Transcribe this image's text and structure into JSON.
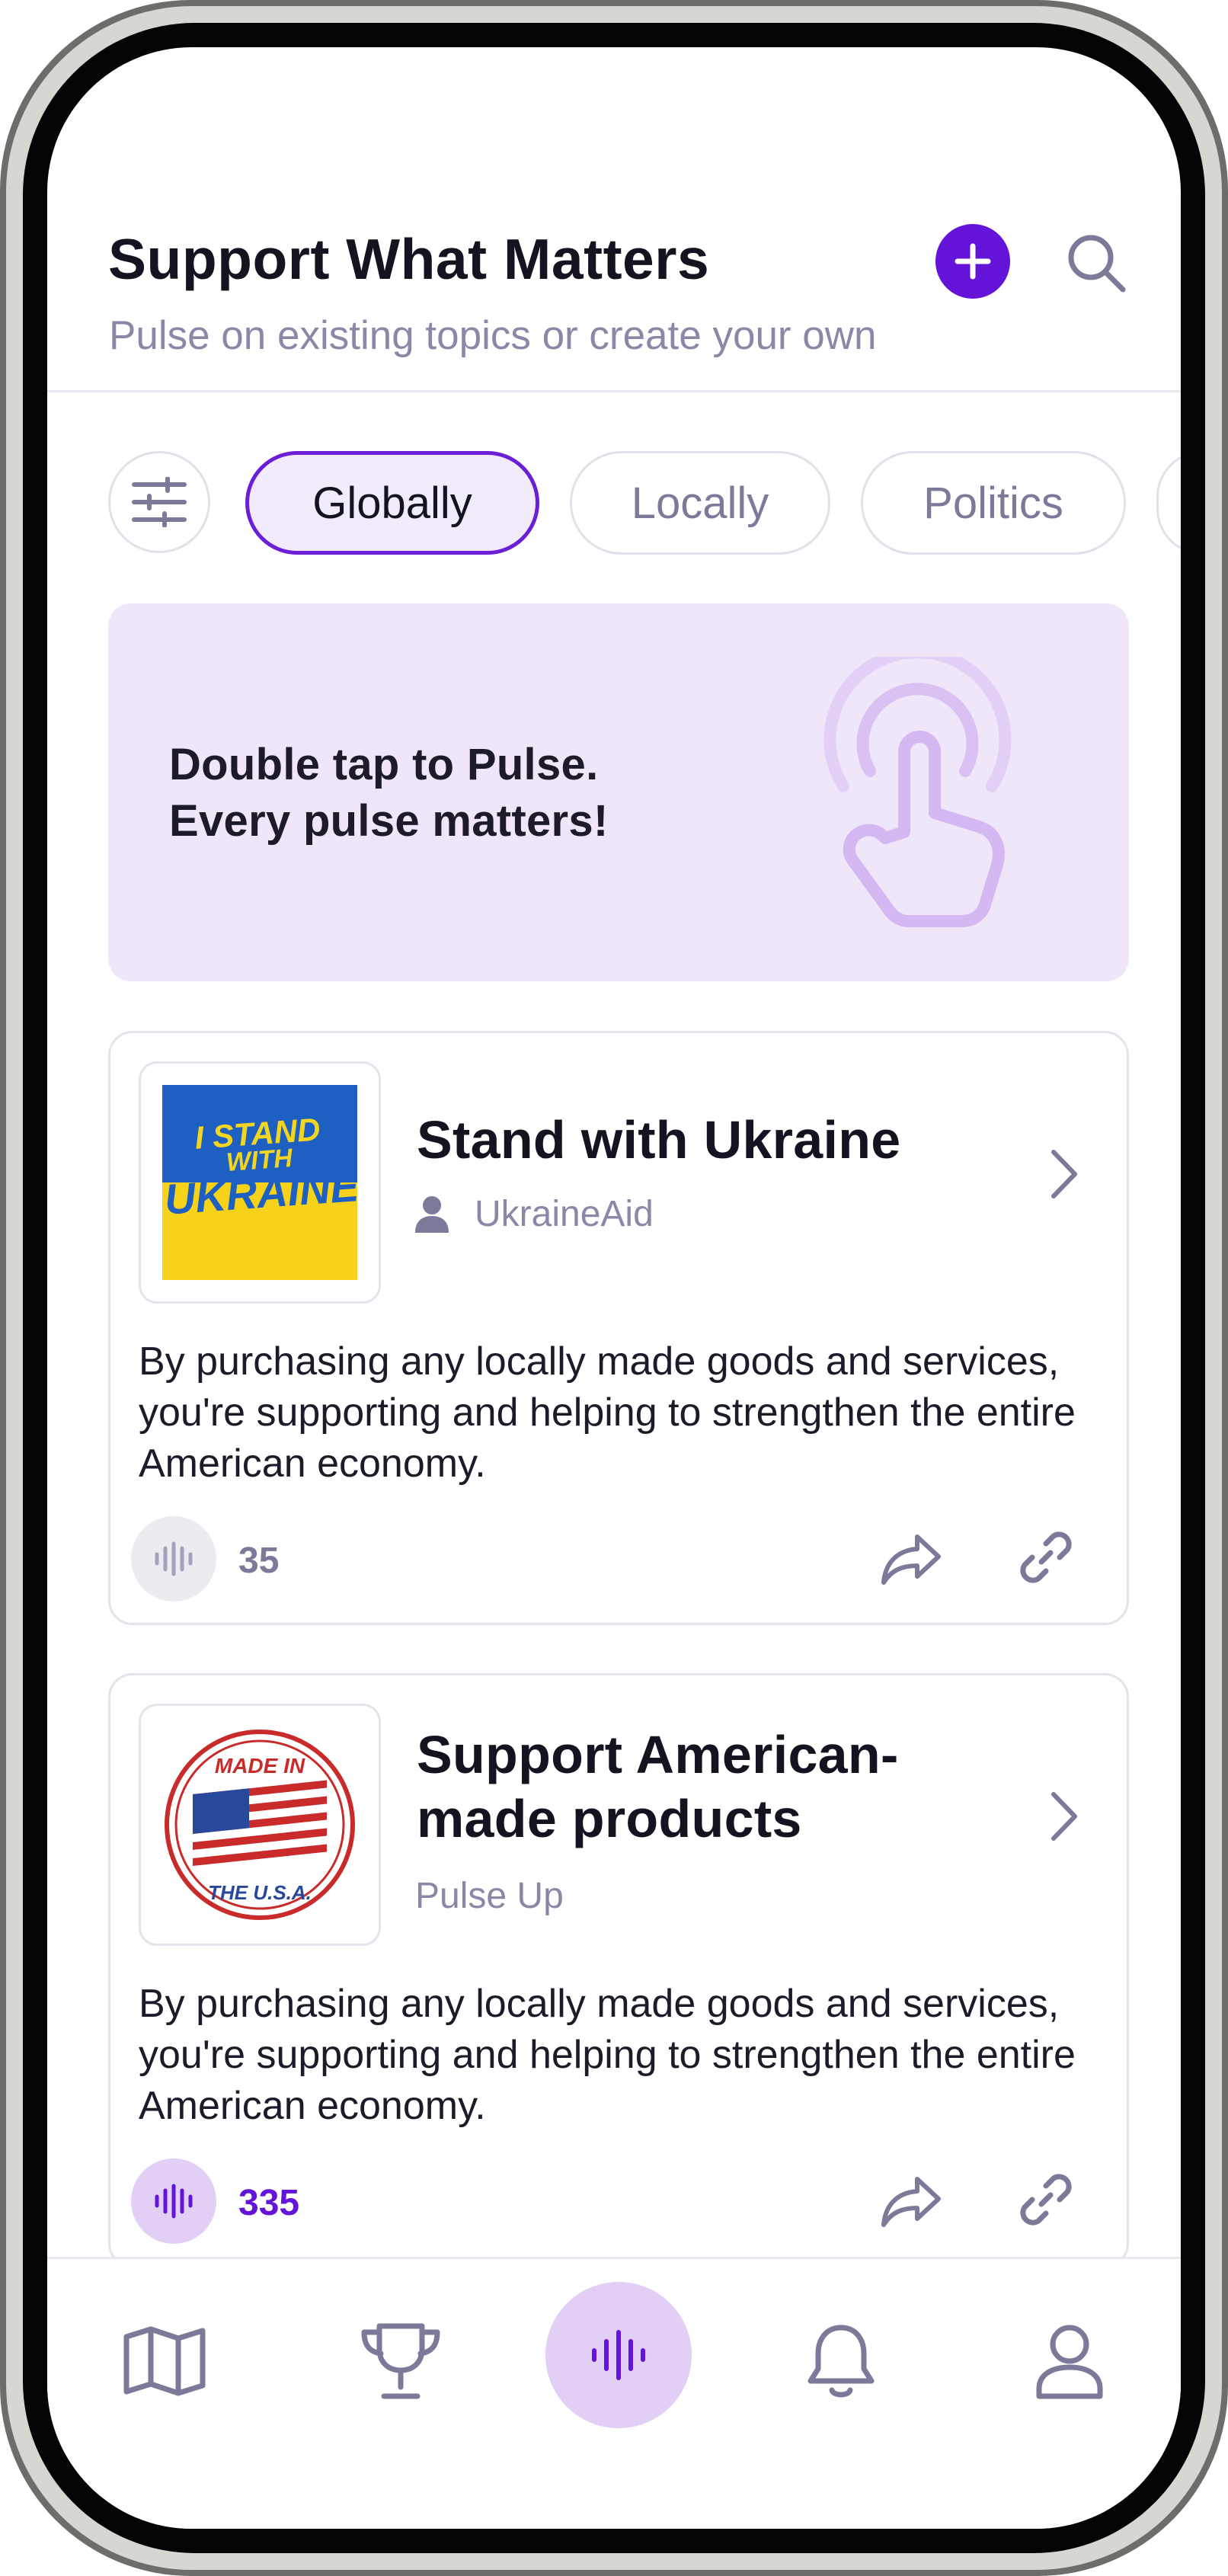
{
  "header": {
    "title": "Support What Matters",
    "subtitle": "Pulse on existing topics or create your own",
    "create_icon": "plus-circle-icon",
    "search_icon": "search-icon"
  },
  "filters": {
    "filter_icon": "sliders-icon",
    "chips": [
      {
        "label": "Globally",
        "active": true
      },
      {
        "label": "Locally",
        "active": false
      },
      {
        "label": "Politics",
        "active": false
      }
    ]
  },
  "banner": {
    "line1": "Double tap to Pulse.",
    "line2": "Every pulse matters!",
    "icon": "tap-hand-icon"
  },
  "topics": [
    {
      "title": "Stand with Ukraine",
      "author": "UkraineAid",
      "author_icon": "user-icon",
      "thumb_text": [
        "I STAND",
        "WITH",
        "UKRAINE"
      ],
      "description": "By purchasing any locally made goods and services, you're supporting and helping to strengthen the entire American economy.",
      "pulse_count": "35",
      "pulsed": false
    },
    {
      "title_line1": "Support American-",
      "title_line2": "made products",
      "author": "Pulse Up",
      "thumb_text": [
        "MADE IN",
        "THE U.S.A."
      ],
      "description": "By purchasing any locally made goods and services, you're supporting and helping to strengthen the entire American economy.",
      "pulse_count": "335",
      "pulsed": true
    }
  ],
  "nav": {
    "items": [
      "map-icon",
      "trophy-icon",
      "pulse-icon",
      "bell-icon",
      "profile-icon"
    ]
  },
  "colors": {
    "accent": "#6414d8",
    "accent_light": "#e2cff6",
    "banner_bg": "#efe6f9",
    "muted_text": "#8a88a6"
  }
}
